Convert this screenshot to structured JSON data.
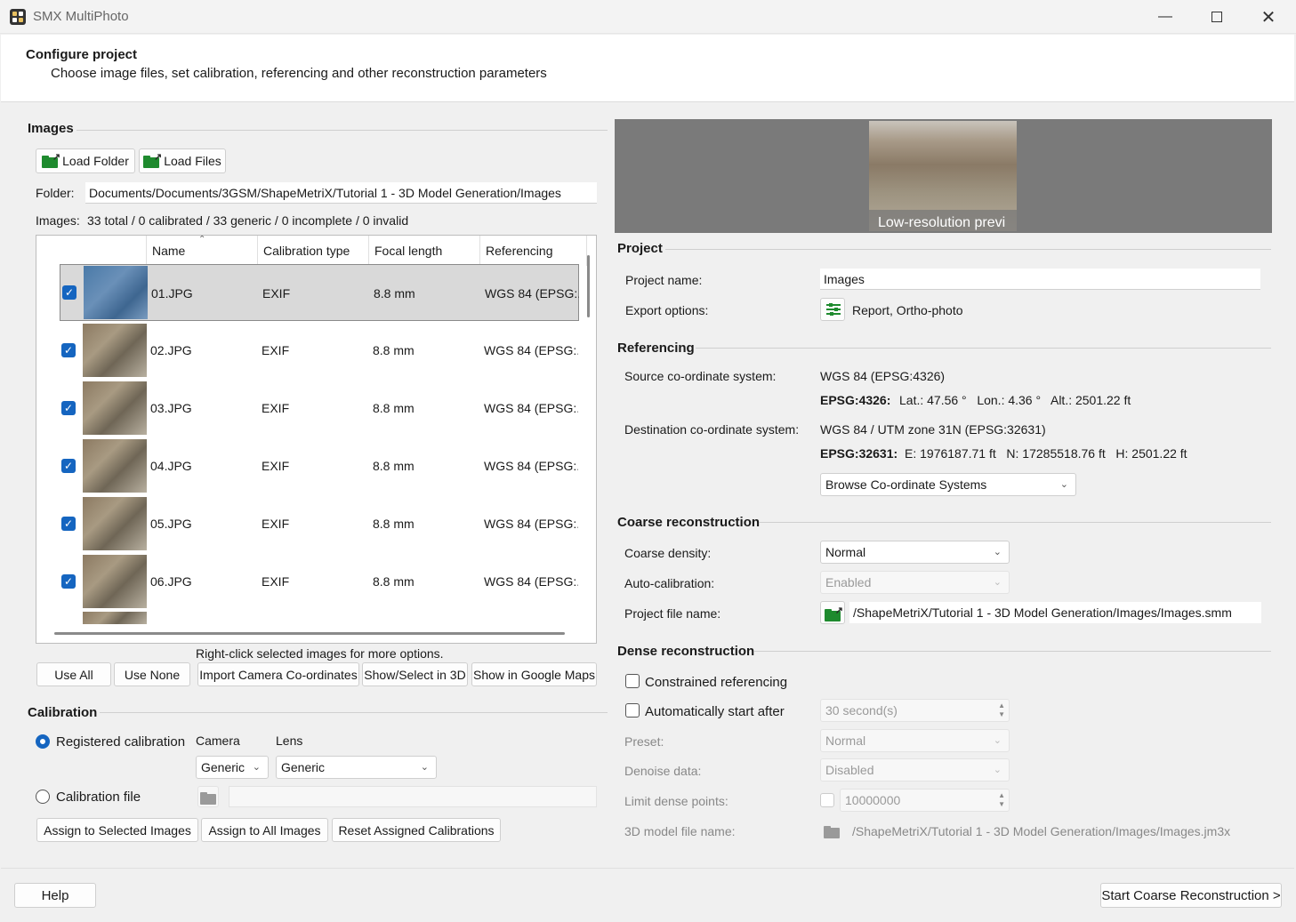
{
  "window": {
    "title": "SMX MultiPhoto"
  },
  "header": {
    "title": "Configure project",
    "subtitle": "Choose image files, set calibration, referencing and other reconstruction parameters"
  },
  "images": {
    "section": "Images",
    "load_folder": "Load Folder",
    "load_files": "Load Files",
    "folder_label": "Folder:",
    "folder_value": "Documents/Documents/3GSM/ShapeMetriX/Tutorial 1 - 3D Model Generation/Images",
    "images_label": "Images:",
    "images_summary": "33 total / 0 calibrated / 33 generic / 0 incomplete / 0 invalid",
    "columns": [
      "Name",
      "Calibration type",
      "Focal length",
      "Referencing"
    ],
    "rows": [
      {
        "name": "01.JPG",
        "cal": "EXIF",
        "focal": "8.8 mm",
        "ref": "WGS 84 (EPSG:..."
      },
      {
        "name": "02.JPG",
        "cal": "EXIF",
        "focal": "8.8 mm",
        "ref": "WGS 84 (EPSG:..."
      },
      {
        "name": "03.JPG",
        "cal": "EXIF",
        "focal": "8.8 mm",
        "ref": "WGS 84 (EPSG:..."
      },
      {
        "name": "04.JPG",
        "cal": "EXIF",
        "focal": "8.8 mm",
        "ref": "WGS 84 (EPSG:..."
      },
      {
        "name": "05.JPG",
        "cal": "EXIF",
        "focal": "8.8 mm",
        "ref": "WGS 84 (EPSG:..."
      },
      {
        "name": "06.JPG",
        "cal": "EXIF",
        "focal": "8.8 mm",
        "ref": "WGS 84 (EPSG:..."
      }
    ],
    "hint": "Right-click selected images for more options.",
    "use_all": "Use All",
    "use_none": "Use None",
    "import_coords": "Import Camera Co-ordinates",
    "show_3d": "Show/Select in 3D",
    "show_maps": "Show in Google Maps"
  },
  "calibration": {
    "section": "Calibration",
    "registered": "Registered calibration",
    "camera_label": "Camera",
    "lens_label": "Lens",
    "camera_value": "Generic",
    "lens_value": "Generic",
    "file": "Calibration file",
    "assign_selected": "Assign to Selected Images",
    "assign_all": "Assign to All Images",
    "reset": "Reset Assigned Calibrations"
  },
  "preview": {
    "caption": "Low-resolution previ"
  },
  "project": {
    "section": "Project",
    "name_label": "Project name:",
    "name_value": "Images",
    "export_label": "Export options:",
    "export_value": "Report, Ortho-photo"
  },
  "referencing": {
    "section": "Referencing",
    "source_label": "Source co-ordinate system:",
    "source_value": "WGS 84 (EPSG:4326)",
    "source_code": "EPSG:4326:",
    "source_coords": "Lat.: 47.56 °   Lon.: 4.36 °   Alt.: 2501.22 ft",
    "dest_label": "Destination co-ordinate system:",
    "dest_value": "WGS 84 / UTM zone 31N (EPSG:32631)",
    "dest_code": "EPSG:32631:",
    "dest_coords": "E: 1976187.71 ft   N: 17285518.76 ft   H: 2501.22 ft",
    "browse": "Browse Co-ordinate Systems"
  },
  "coarse": {
    "section": "Coarse reconstruction",
    "density_label": "Coarse density:",
    "density_value": "Normal",
    "autocal_label": "Auto-calibration:",
    "autocal_value": "Enabled",
    "file_label": "Project file name:",
    "file_value": "/ShapeMetriX/Tutorial 1 - 3D Model Generation/Images/Images.smm"
  },
  "dense": {
    "section": "Dense reconstruction",
    "constrained": "Constrained referencing",
    "autostart": "Automatically start after",
    "autostart_value": "30 second(s)",
    "preset_label": "Preset:",
    "preset_value": "Normal",
    "denoise_label": "Denoise data:",
    "denoise_value": "Disabled",
    "limit_label": "Limit dense points:",
    "limit_value": "10000000",
    "model_label": "3D model file name:",
    "model_value": "/ShapeMetriX/Tutorial 1 - 3D Model Generation/Images/Images.jm3x"
  },
  "footer": {
    "help": "Help",
    "start": "Start Coarse Reconstruction >"
  },
  "colors": {
    "accent": "#1565c0",
    "folder_green": "#1e8a2e",
    "preview_bg": "#7a7a7a"
  }
}
